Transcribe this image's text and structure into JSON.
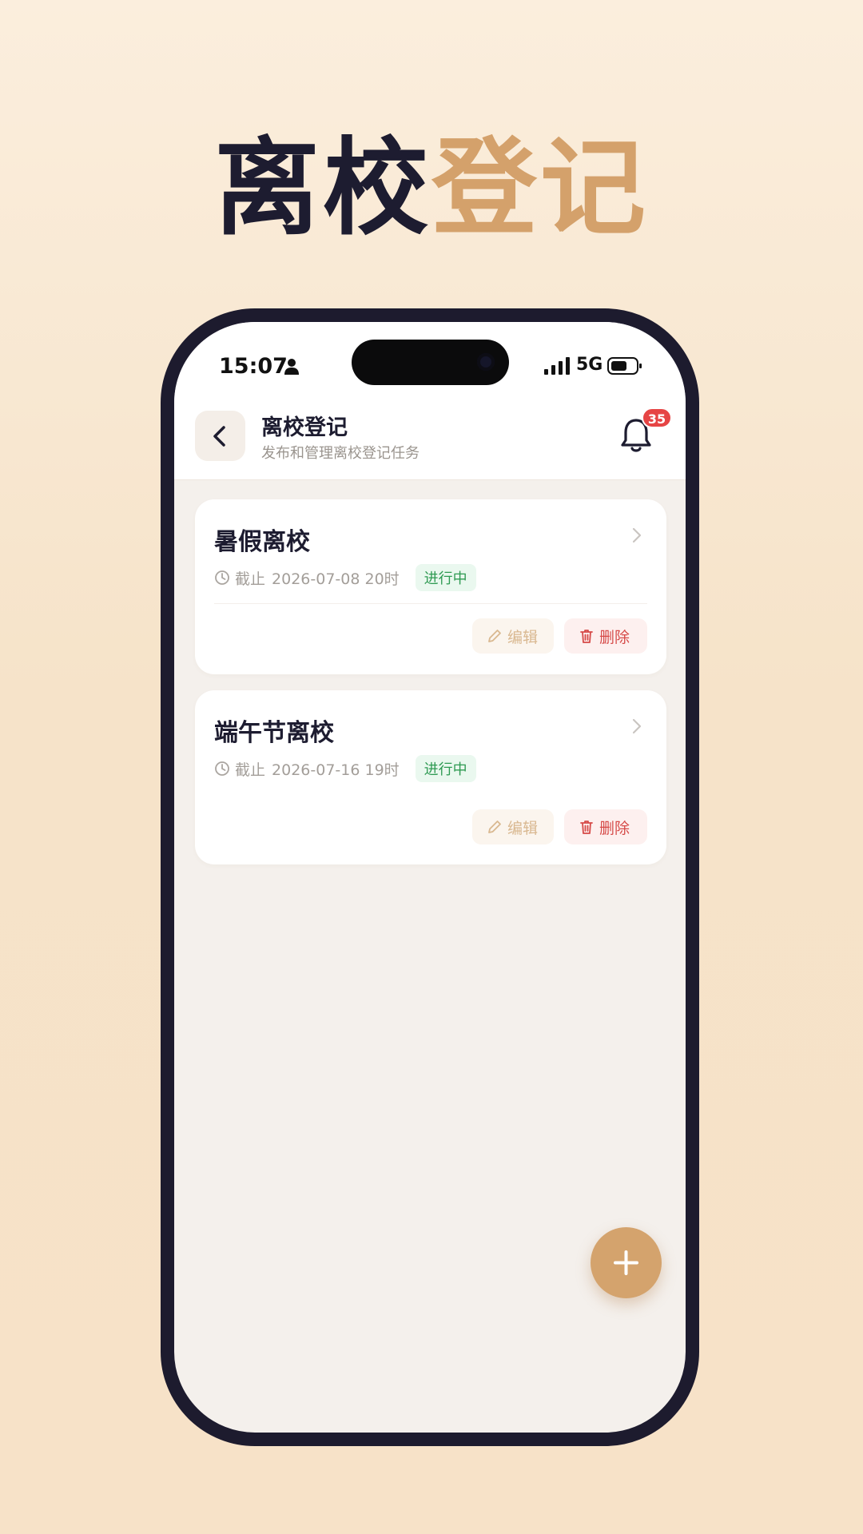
{
  "hero": {
    "title_dark": "离校",
    "title_accent": "登记"
  },
  "statusbar": {
    "time": "15:07",
    "network": "5G",
    "icons": [
      "person-icon",
      "signal-icon",
      "battery-icon"
    ]
  },
  "header": {
    "title": "离校登记",
    "subtitle": "发布和管理离校登记任务",
    "notification_count": "35",
    "icons": [
      "chevron-left-icon",
      "bell-icon"
    ]
  },
  "tasks": [
    {
      "title": "暑假离校",
      "deadline_label": "截止",
      "deadline": "2026-07-08 20时",
      "status": "进行中",
      "edit_label": "编辑",
      "delete_label": "删除"
    },
    {
      "title": "端午节离校",
      "deadline_label": "截止",
      "deadline": "2026-07-16 19时",
      "status": "进行中",
      "edit_label": "编辑",
      "delete_label": "删除"
    }
  ],
  "fab": {
    "icon": "plus-icon"
  },
  "colors": {
    "accent": "#d4a16b",
    "dark": "#1d1c30",
    "status_green": "#2e9a52",
    "danger_red": "#d64a48",
    "badge_red": "#e64545"
  }
}
